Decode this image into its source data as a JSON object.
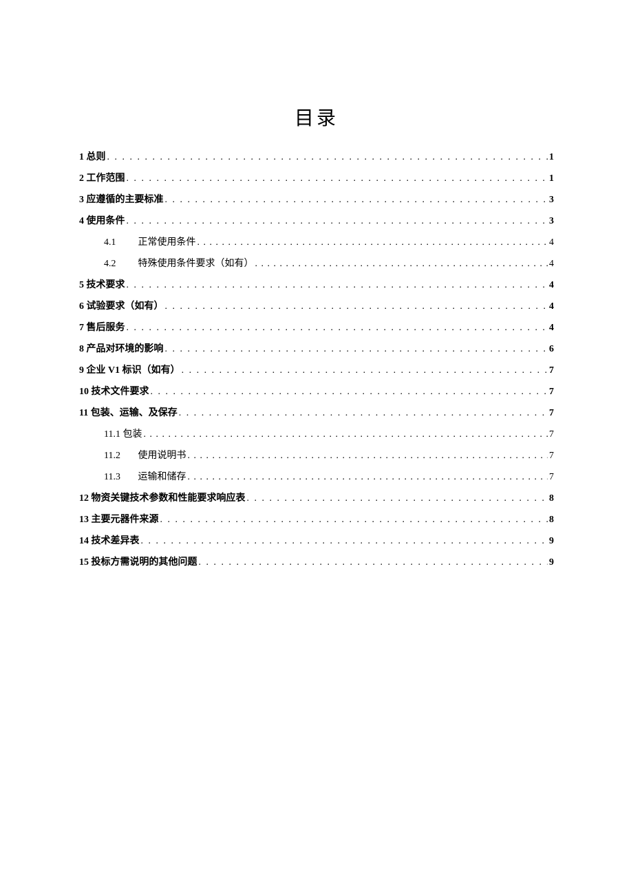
{
  "title": "目录",
  "entries": [
    {
      "level": 1,
      "num": "1",
      "text": "总则",
      "page": "1"
    },
    {
      "level": 1,
      "num": "2",
      "text": "工作范围",
      "page": "1"
    },
    {
      "level": 1,
      "num": "3",
      "text": "应遵循的主要标准",
      "page": "3"
    },
    {
      "level": 1,
      "num": "4",
      "text": "使用条件",
      "page": "3"
    },
    {
      "level": 2,
      "num": "4.1",
      "text": "正常使用条件",
      "page": "4"
    },
    {
      "level": 2,
      "num": "4.2",
      "text": "特殊使用条件要求（如有）",
      "page": "4"
    },
    {
      "level": 1,
      "num": "5",
      "text": "技术要求",
      "page": "4"
    },
    {
      "level": 1,
      "num": "6",
      "text": "试验要求（如有）",
      "page": "4"
    },
    {
      "level": 1,
      "num": "7",
      "text": "售后服务",
      "page": "4"
    },
    {
      "level": 1,
      "num": "8",
      "text": "产品对环境的影响",
      "page": "6"
    },
    {
      "level": 1,
      "num": "9",
      "text": "企业 V1 标识（如有）",
      "page": "7"
    },
    {
      "level": 1,
      "num": "10",
      "text": "技术文件要求",
      "page": "7"
    },
    {
      "level": 1,
      "num": "11",
      "text": "包装、运输、及保存",
      "page": "7"
    },
    {
      "level": 2,
      "num": "11.1",
      "text": "包装",
      "page": "7",
      "nogap": true
    },
    {
      "level": 2,
      "num": "11.2",
      "text": "使用说明书",
      "page": "7"
    },
    {
      "level": 2,
      "num": "11.3",
      "text": "运输和储存",
      "page": "7"
    },
    {
      "level": 1,
      "num": "12",
      "text": "物资关键技术参数和性能要求响应表",
      "page": "8"
    },
    {
      "level": 1,
      "num": "13",
      "text": "主要元器件来源",
      "page": "8"
    },
    {
      "level": 1,
      "num": "14",
      "text": "技术差异表",
      "page": "9"
    },
    {
      "level": 1,
      "num": "15",
      "text": "投标方需说明的其他问题",
      "page": "9"
    }
  ]
}
